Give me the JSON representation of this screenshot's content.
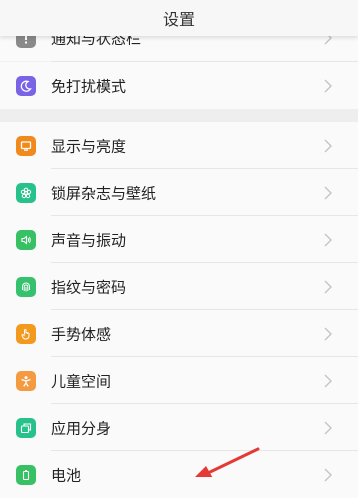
{
  "header": {
    "title": "设置"
  },
  "items": [
    {
      "label": "通知与状态栏",
      "icon": "notification-icon",
      "color": "#8a8a8a"
    },
    {
      "label": "免打扰模式",
      "icon": "moon-icon",
      "color": "#7b63e6"
    },
    {
      "label": "显示与亮度",
      "icon": "display-icon",
      "color": "#f08a1c"
    },
    {
      "label": "锁屏杂志与壁纸",
      "icon": "flower-icon",
      "color": "#27c28c"
    },
    {
      "label": "声音与振动",
      "icon": "speaker-icon",
      "color": "#38c065"
    },
    {
      "label": "指纹与密码",
      "icon": "fingerprint-icon",
      "color": "#36c16e"
    },
    {
      "label": "手势体感",
      "icon": "hand-icon",
      "color": "#f39a1e"
    },
    {
      "label": "儿童空间",
      "icon": "child-icon",
      "color": "#f49b41"
    },
    {
      "label": "应用分身",
      "icon": "clone-icon",
      "color": "#27c28c"
    },
    {
      "label": "电池",
      "icon": "battery-icon",
      "color": "#38c065"
    }
  ],
  "colors": {
    "annotation_arrow": "#e53935"
  }
}
